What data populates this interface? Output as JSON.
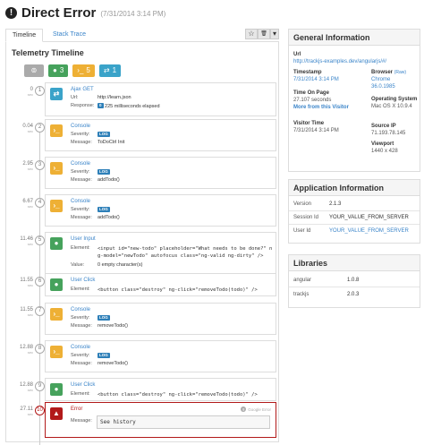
{
  "header": {
    "title": "Direct Error",
    "date": "(7/31/2014 3:14 PM)"
  },
  "tabs": {
    "timeline": "Timeline",
    "stack_trace": "Stack Trace"
  },
  "toolbar": {
    "star": "☆",
    "trash": "🗑",
    "caret": "▾"
  },
  "telemetry": {
    "title": "Telemetry Timeline",
    "chips": [
      {
        "label": "",
        "color": "#aaaaaa",
        "icon": "filter-icon"
      },
      {
        "label": "3",
        "color": "#46a25c",
        "icon": "user-icon"
      },
      {
        "label": "5",
        "color": "#eeb035",
        "icon": "console-icon"
      },
      {
        "label": "1",
        "color": "#3aa3c9",
        "icon": "network-icon"
      }
    ],
    "items": [
      {
        "time": "0",
        "unit": "sec",
        "num": "1",
        "title": "Ajax GET",
        "rows": [
          {
            "label": "Url:",
            "value": "http://learn.json"
          },
          {
            "label": "Response:",
            "badge": "0",
            "value": "225 milliseconds elapsed"
          }
        ]
      },
      {
        "time": "0.04",
        "unit": "sec",
        "num": "2",
        "title": "Console",
        "rows": [
          {
            "label": "Severity:",
            "badge": "LOG"
          },
          {
            "label": "Message:",
            "value": "ToDoCtrl Init"
          }
        ]
      },
      {
        "time": "2.95",
        "unit": "sec",
        "num": "3",
        "title": "Console",
        "rows": [
          {
            "label": "Severity:",
            "badge": "LOG"
          },
          {
            "label": "Message:",
            "value": "addTodo()"
          }
        ]
      },
      {
        "time": "6.67",
        "unit": "sec",
        "num": "4",
        "title": "Console",
        "rows": [
          {
            "label": "Severity:",
            "badge": "LOG"
          },
          {
            "label": "Message:",
            "value": "addTodo()"
          }
        ]
      },
      {
        "time": "11.46",
        "unit": "sec",
        "num": "5",
        "title": "User Input",
        "code1": "<input id=\"new-todo\" placeholder=\"What needs to be done?\" n",
        "code2": "g-model=\"newTodo\" autofocus class=\"ng-valid ng-dirty\" />",
        "value_label": "Value:",
        "value": "0 empty character(s)",
        "element_label": "Element:"
      },
      {
        "time": "11.55",
        "unit": "sec",
        "num": "6",
        "title": "User Click",
        "element_label": "Element:",
        "code1": "<button class=\"destroy\" ng-click=\"removeTodo(todo)\" />"
      },
      {
        "time": "11.55",
        "unit": "sec",
        "num": "7",
        "title": "Console",
        "rows": [
          {
            "label": "Severity:",
            "badge": "LOG"
          },
          {
            "label": "Message:",
            "value": "removeTodo()"
          }
        ]
      },
      {
        "time": "12.88",
        "unit": "sec",
        "num": "8",
        "title": "Console",
        "rows": [
          {
            "label": "Severity:",
            "badge": "LOG"
          },
          {
            "label": "Message:",
            "value": "removeTodo()"
          }
        ]
      },
      {
        "time": "12.88",
        "unit": "sec",
        "num": "9",
        "title": "User Click",
        "element_label": "Element:",
        "code1": "<button class=\"destroy\" ng-click=\"removeTodo(todo)\" />"
      },
      {
        "time": "27.11",
        "unit": "sec",
        "num": "10",
        "title": "Error",
        "source": "Google Error",
        "message_label": "Message:",
        "message": "See history"
      }
    ]
  },
  "general": {
    "title": "General Information",
    "url_label": "Url",
    "url": "http://trackjs-examples.dev/angularjs/#/",
    "timestamp_label": "Timestamp",
    "timestamp": "7/31/2014 3:14 PM",
    "browser_label": "Browser",
    "browser_raw": "(Raw)",
    "browser": "Chrome",
    "browser_version": "36.0.1985",
    "time_on_page_label": "Time On Page",
    "time_on_page": "27.107 seconds",
    "more_visitor": "More from this Visitor",
    "os_label": "Operating System",
    "os": "Mac OS X 10.9.4",
    "visitor_time_label": "Visitor Time",
    "visitor_time": "7/31/2014 3:14 PM",
    "source_ip_label": "Source IP",
    "source_ip": "71.193.78.145",
    "viewport_label": "Viewport",
    "viewport": "1440 x 428"
  },
  "application": {
    "title": "Application Information",
    "rows": [
      {
        "label": "Version",
        "value": "2.1.3"
      },
      {
        "label": "Session Id",
        "value": "YOUR_VALUE_FROM_SERVER"
      },
      {
        "label": "User Id",
        "value": "YOUR_VALUE_FROM_SERVER"
      }
    ]
  },
  "libraries": {
    "title": "Libraries",
    "rows": [
      {
        "label": "angular",
        "value": "1.0.8"
      },
      {
        "label": "trackjs",
        "value": "2.0.3"
      }
    ]
  },
  "colors": {
    "ajax": "#3aa3c9",
    "console": "#eeb035",
    "user": "#46a25c",
    "error": "#b21a1a",
    "link": "#3a84c9"
  }
}
